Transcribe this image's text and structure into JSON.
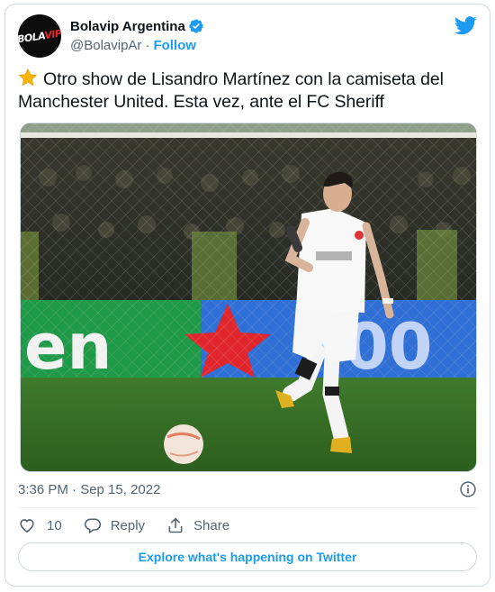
{
  "author": {
    "name": "Bolavip Argentina",
    "handle": "@BolavipAr",
    "separator": "·",
    "follow_label": "Follow",
    "avatar_logo_text": "BOLAVIP",
    "verified": true
  },
  "tweet": {
    "emoji": "star",
    "text": "Otro show de Lisandro Martínez con la camiseta del Manchester United. Esta vez, ante el FC Sheriff",
    "timestamp": "3:36 PM · Sep 15, 2022"
  },
  "media": {
    "type": "photo",
    "description": "Football player in white away kit passing a ball on a pitch"
  },
  "actions": {
    "like_count": "10",
    "reply_label": "Reply",
    "share_label": "Share"
  },
  "footer": {
    "explore_label": "Explore what's happening on Twitter"
  },
  "colors": {
    "accent": "#1d9bf0",
    "text_primary": "#0f1419",
    "text_secondary": "#536471",
    "border": "#cfd9de"
  },
  "icons": [
    "verified-badge-icon",
    "twitter-bird-icon",
    "star-emoji-icon",
    "info-icon",
    "heart-icon",
    "reply-icon",
    "share-icon"
  ]
}
